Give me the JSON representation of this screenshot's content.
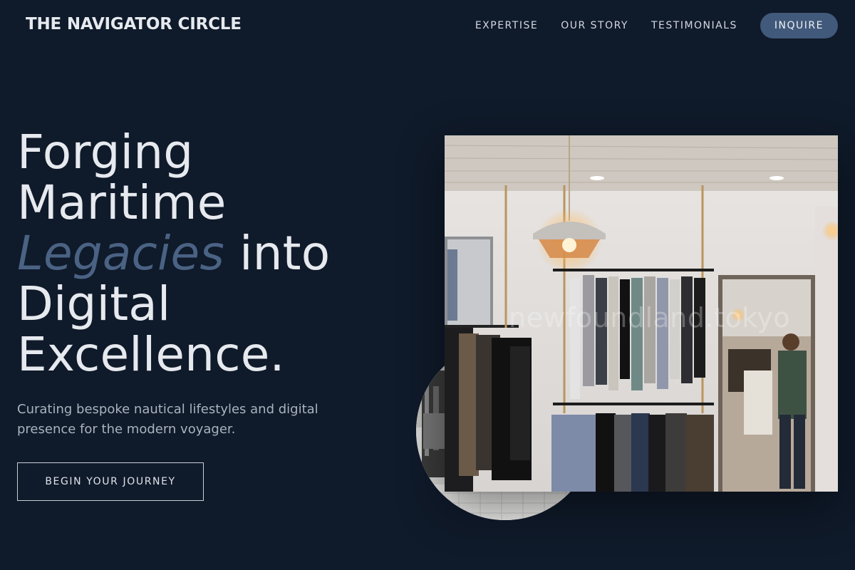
{
  "header": {
    "logo": "THE NAVIGATOR CIRCLE",
    "nav": [
      {
        "label": "EXPERTISE"
      },
      {
        "label": "OUR STORY"
      },
      {
        "label": "TESTIMONIALS"
      }
    ],
    "cta_label": "INQUIRE"
  },
  "hero": {
    "title_line1": "Forging",
    "title_line2": "Maritime",
    "title_accent": "Legacies",
    "title_line3_rest": " into",
    "title_line4": "Digital",
    "title_line5": "Excellence.",
    "subtitle": "Curating bespoke nautical lifestyles and digital presence for the modern voyager.",
    "cta_label": "BEGIN YOUR JOURNEY"
  },
  "visual": {
    "watermark": "newfoundland.tokyo"
  },
  "colors": {
    "background": "#0f1a2a",
    "accent": "#4a6283",
    "button": "#41597a"
  }
}
